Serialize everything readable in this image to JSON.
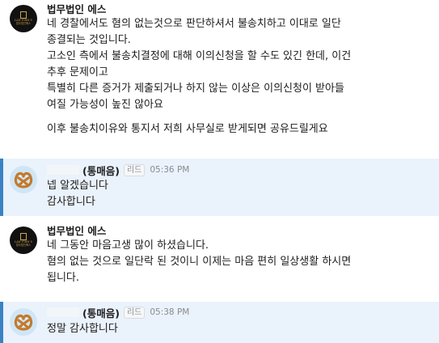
{
  "messages": [
    {
      "sender": "법무법인 에스",
      "avatar_text": [
        "LAW FIRM S",
        "법무법인에스"
      ],
      "lines": [
        "네 경찰에서도 혐의 없는것으로 판단하셔서 불송치하고 이대로 일단",
        "종결되는 것입니다.",
        "고소인 측에서 불송치결정에 대해 이의신청을 할 수도 있긴 한데, 이건",
        "추후 문제이고",
        "특별히 다른 증거가 제출되거나 하지 않는 이상은 이의신청이 받아들",
        "여질 가능성이 높진 않아요",
        "이후 불송치이유와 통지서 저희 사무실로 받게되면 공유드릴게요"
      ]
    },
    {
      "sender": "(통매음)",
      "tag": "리드",
      "time": "05:36 PM",
      "lines": [
        "넵 알겠습니다",
        "감사합니다"
      ]
    },
    {
      "sender": "법무법인 에스",
      "avatar_text": [
        "LAW FIRM S",
        "법무법인에스"
      ],
      "lines": [
        "네 그동안 마음고생 많이 하셨습니다.",
        "혐의 없는 것으로 일단락 된 것이니 이제는 마음 편히 일상생활 하시면",
        "됩니다."
      ]
    },
    {
      "sender": "(통매음)",
      "tag": "리드",
      "time": "05:38 PM",
      "lines": [
        "정말 감사합니다"
      ]
    }
  ]
}
